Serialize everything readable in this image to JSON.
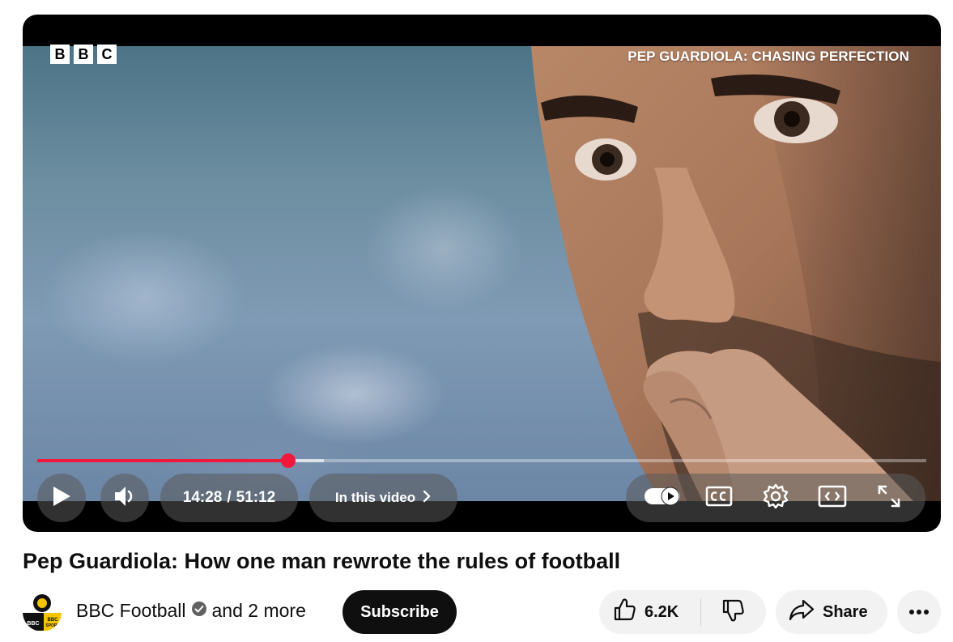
{
  "player": {
    "logo_letters": [
      "B",
      "B",
      "C"
    ],
    "documentary_title": "PEP GUARDIOLA: CHASING PERFECTION",
    "current_time": "14:28",
    "duration": "51:12",
    "time_separator": "/",
    "progress_fraction": 0.2826,
    "buffered_fraction": 0.3226,
    "chapters_label": "In this video",
    "accent_color": "#f0193b"
  },
  "video": {
    "title": "Pep Guardiola: How one man rewrote the rules of football",
    "channel_name": "BBC Football",
    "channel_suffix": "and 2 more",
    "subscribe_label": "Subscribe",
    "like_count": "6.2K",
    "share_label": "Share",
    "avatar_texts": [
      "BBC",
      "BBC",
      "SPORT"
    ]
  },
  "icons": [
    "play-icon",
    "volume-icon",
    "chevron-right-icon",
    "autoplay-toggle-icon",
    "captions-icon",
    "settings-gear-icon",
    "miniplayer-icon",
    "fullscreen-icon",
    "verified-badge-icon",
    "thumbs-up-icon",
    "thumbs-down-icon",
    "share-arrow-icon",
    "more-dots-icon"
  ]
}
